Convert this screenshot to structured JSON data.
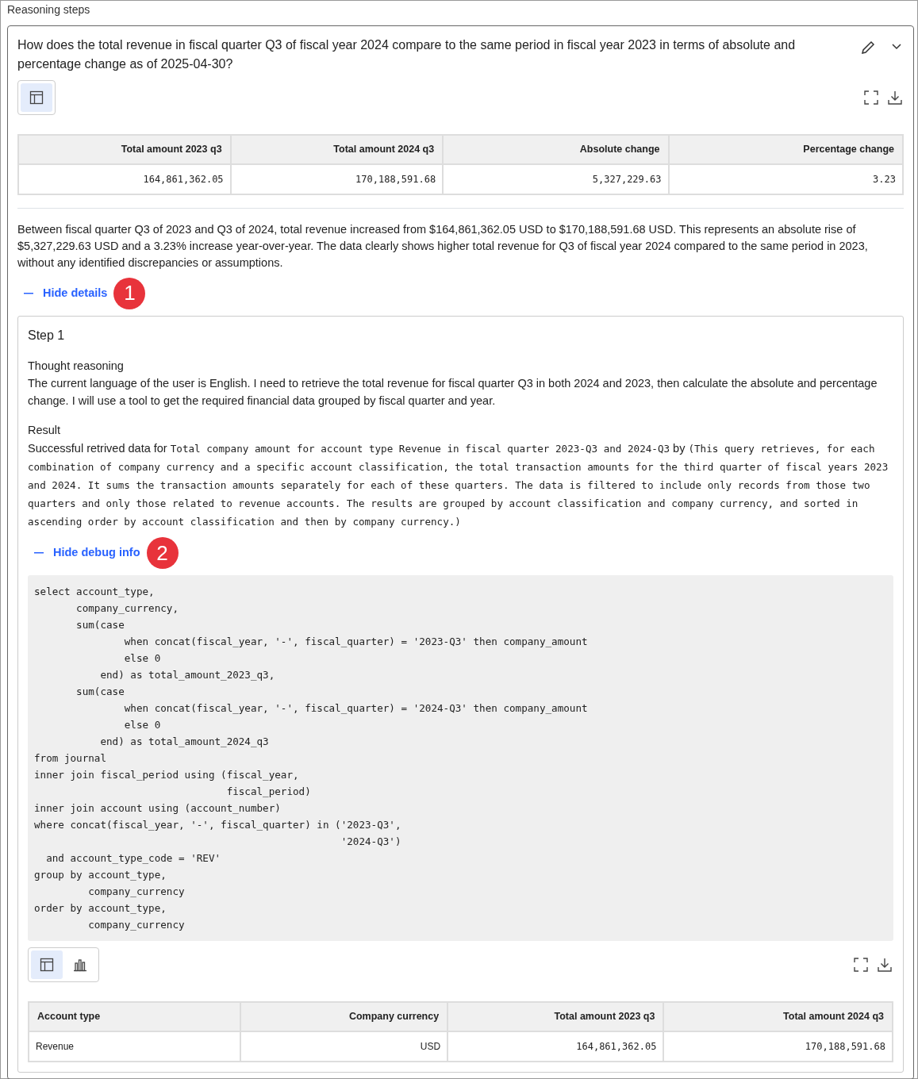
{
  "section_title": "Reasoning steps",
  "question": {
    "text": "How does the total revenue in fiscal quarter Q3 of fiscal year 2024 compare to the same period in fiscal year 2023 in terms of absolute and percentage change as of 2025-04-30?",
    "expanded": true
  },
  "answer_table": {
    "views": [
      {
        "kind": "table",
        "selected": true
      }
    ],
    "columns": [
      "Total amount 2023 q3",
      "Total amount 2024 q3",
      "Absolute change",
      "Percentage change"
    ],
    "rows": [
      [
        "164,861,362.05",
        "170,188,591.68",
        "5,327,229.63",
        "3.23"
      ]
    ]
  },
  "summary": "Between fiscal quarter Q3 of 2023 and Q3 of 2024, total revenue increased from $164,861,362.05 USD to $170,188,591.68 USD. This represents an absolute rise of $5,327,229.63 USD and a 3.23% increase year-over-year. The data clearly shows higher total revenue for Q3 of fiscal year 2024 compared to the same period in 2023, without any identified discrepancies or assumptions.",
  "details_toggle": {
    "label": "Hide details",
    "expanded": true,
    "badge": "1"
  },
  "step": {
    "title": "Step 1",
    "thought_label": "Thought reasoning",
    "thought": "The current language of the user is English. I need to retrieve the total revenue for fiscal quarter Q3 in both 2024 and 2023, then calculate the absolute and percentage change. I will use a tool to get the required financial data grouped by fiscal quarter and year.",
    "result_label": "Result",
    "result": [
      {
        "code": false,
        "text": "Successful retrived data for "
      },
      {
        "code": true,
        "text": "Total company amount for account type Revenue in fiscal quarter 2023-Q3 and 2024-Q3"
      },
      {
        "code": false,
        "text": " by "
      },
      {
        "code": true,
        "text": "(This query retrieves, for each combination of company currency and a specific account classification, the total transaction amounts for the third quarter of fiscal years 2023 and 2024. It sums the transaction amounts separately for each of these quarters. The data is filtered to include only records from those two quarters and only those related to revenue accounts. The results are grouped by account classification and company currency, and sorted in ascending order by account classification and then by company currency.)"
      }
    ],
    "debug_toggle": {
      "label": "Hide debug info",
      "expanded": true,
      "badge": "2"
    },
    "sql": [
      "select account_type,",
      "       company_currency,",
      "       sum(case",
      "               when concat(fiscal_year, '-', fiscal_quarter) = '2023-Q3' then company_amount",
      "               else 0",
      "           end) as total_amount_2023_q3,",
      "       sum(case",
      "               when concat(fiscal_year, '-', fiscal_quarter) = '2024-Q3' then company_amount",
      "               else 0",
      "           end) as total_amount_2024_q3",
      "from journal",
      "inner join fiscal_period using (fiscal_year,",
      "                                fiscal_period)",
      "inner join account using (account_number)",
      "where concat(fiscal_year, '-', fiscal_quarter) in ('2023-Q3',",
      "                                                   '2024-Q3')",
      "  and account_type_code = 'REV'",
      "group by account_type,",
      "         company_currency",
      "order by account_type,",
      "         company_currency"
    ],
    "result_table": {
      "views": [
        {
          "kind": "table",
          "selected": true
        },
        {
          "kind": "chart",
          "selected": false
        }
      ],
      "columns": [
        "Account type",
        "Company currency",
        "Total amount 2023 q3",
        "Total amount 2024 q3"
      ],
      "rows": [
        [
          "Revenue",
          "USD",
          "164,861,362.05",
          "170,188,591.68"
        ]
      ]
    }
  }
}
